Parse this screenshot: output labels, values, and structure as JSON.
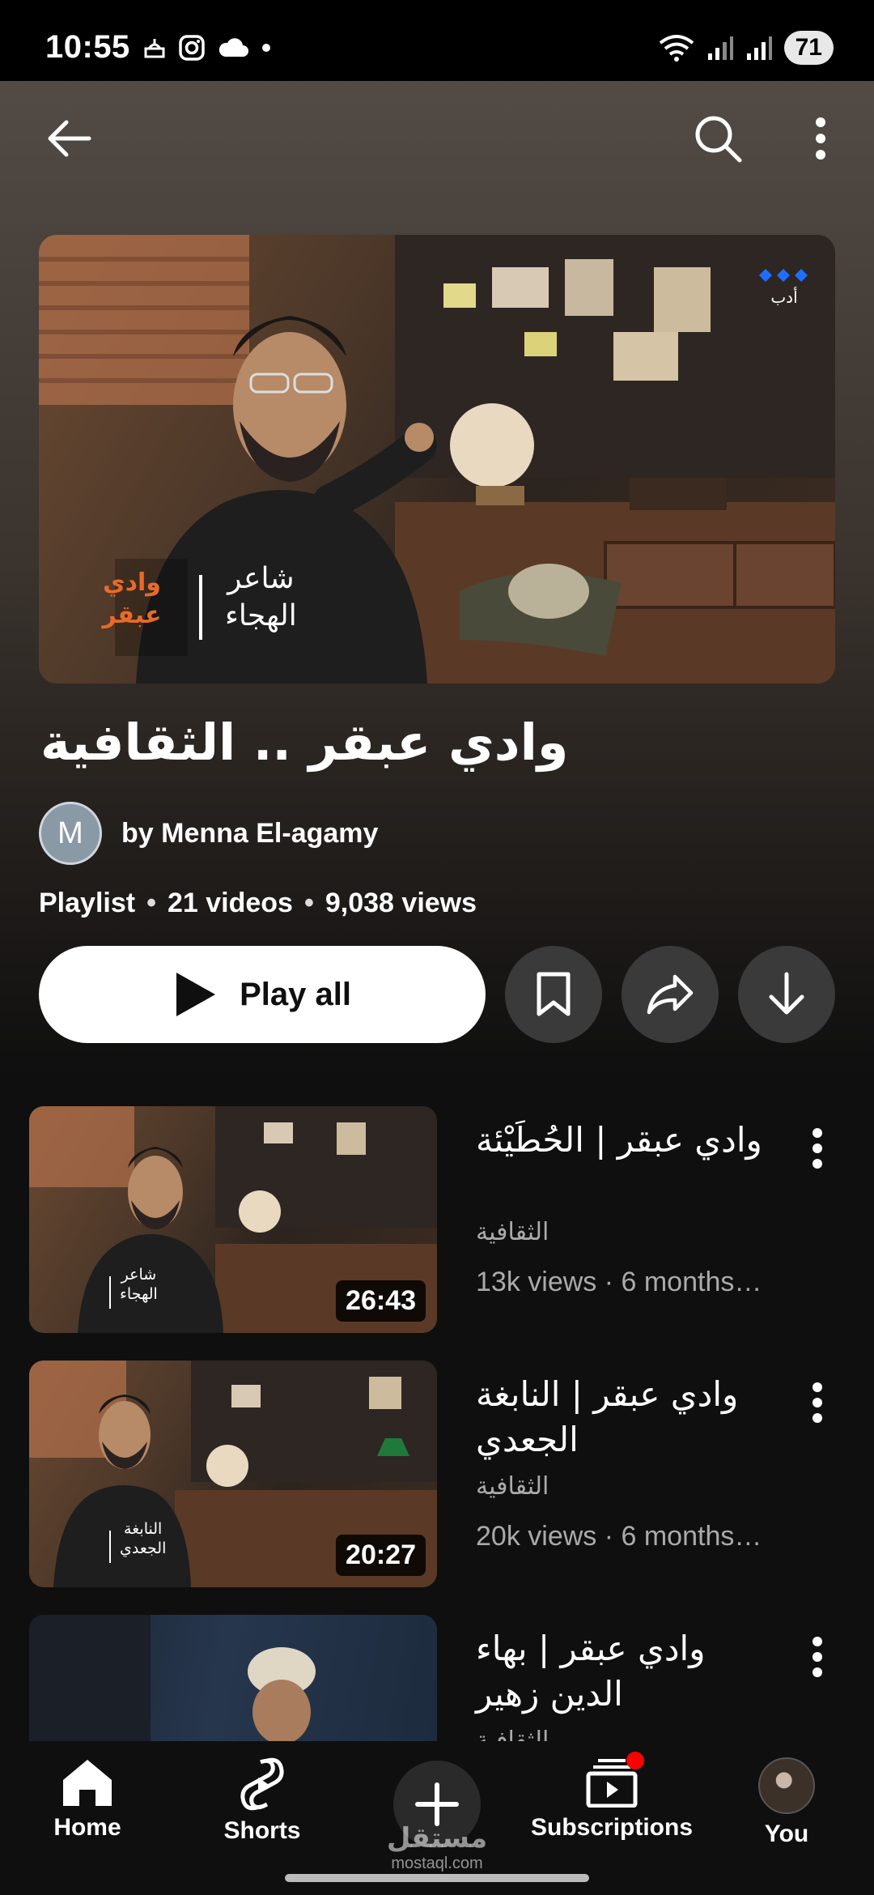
{
  "status_bar": {
    "time": "10:55",
    "battery": "71"
  },
  "top_bar": {
    "icons": [
      "back-arrow-icon",
      "search-icon",
      "more-vert-icon"
    ]
  },
  "hero": {
    "overlay_line1": "شاعر",
    "overlay_line2": "الهجاء",
    "logo_text": "وادي عبقر",
    "brand_text": "أدب"
  },
  "playlist": {
    "title": "وادي عبقر .. الثقافية",
    "avatar_letter": "M",
    "owner": "by Menna El-agamy",
    "type": "Playlist",
    "video_count": "21 videos",
    "views": "9,038 views",
    "play_all_label": "Play all"
  },
  "videos": [
    {
      "title": "وادي عبقر | الحُطَيْئة",
      "channel": "الثقافية",
      "stats": "13k views · 6 months…",
      "duration": "26:43",
      "thumb_line1": "شاعر",
      "thumb_line2": "الهجاء"
    },
    {
      "title": "وادي عبقر | النابغة الجعدي",
      "channel": "الثقافية",
      "stats": "20k views · 6 months…",
      "duration": "20:27",
      "thumb_line1": "النابغة",
      "thumb_line2": "الجعدي"
    },
    {
      "title": "وادي عبقر | بهاء الدين زهير",
      "channel": "الثقافية",
      "stats": "",
      "duration": ""
    }
  ],
  "bottom_nav": {
    "home": "Home",
    "shorts": "Shorts",
    "subscriptions": "Subscriptions",
    "you": "You",
    "watermark_ar": "مستقل",
    "watermark_en": "mostaql.com"
  },
  "colors": {
    "background": "#0f0f0f",
    "button_gray": "#3a3a3a",
    "notification_dot": "#ff0000",
    "brand_dots": "#1e6fff"
  }
}
